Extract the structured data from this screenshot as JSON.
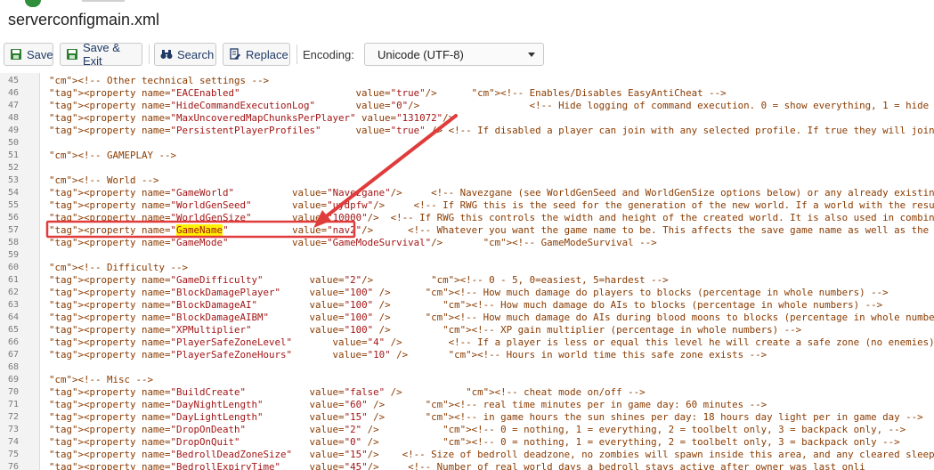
{
  "window": {
    "title": "serverconfigmain.xml"
  },
  "toolbar": {
    "save_label": "Save",
    "save_exit_label": "Save & Exit",
    "search_label": "Search",
    "replace_label": "Replace",
    "encoding_label": "Encoding:",
    "encoding_value": "Unicode (UTF-8)"
  },
  "highlight": {
    "search_match": "GameName"
  },
  "colors": {
    "annotation": "#e03c3c",
    "match_highlight": "#fff200"
  },
  "lines": [
    {
      "n": "45",
      "text": "<!-- Other technical settings -->"
    },
    {
      "n": "46",
      "text": "<property name=\"EACEnabled\"                    value=\"true\"/>      <!-- Enables/Disables EasyAntiCheat -->"
    },
    {
      "n": "47",
      "text": "<property name=\"HideCommandExecutionLog\"       value=\"0\"/>                   <!-- Hide logging of command execution. 0 = show everything, 1 = hide only from"
    },
    {
      "n": "48",
      "text": "<property name=\"MaxUncoveredMapChunksPerPlayer\" value=\"131072\"/>"
    },
    {
      "n": "49",
      "text": "<property name=\"PersistentPlayerProfiles\"      value=\"true\" /> <!-- If disabled a player can join with any selected profile. If true they will join with t"
    },
    {
      "n": "50",
      "text": ""
    },
    {
      "n": "51",
      "text": "<!-- GAMEPLAY -->"
    },
    {
      "n": "52",
      "text": ""
    },
    {
      "n": "53",
      "text": "<!-- World -->"
    },
    {
      "n": "54",
      "text": "<property name=\"GameWorld\"          value=\"Navezgane\"/>     <!-- Navezgane (see WorldGenSeed and WorldGenSize options below) or any already existing world"
    },
    {
      "n": "55",
      "text": "<property name=\"WorldGenSeed\"       value=\"uydpfw\"/>     <!-- If RWG this is the seed for the generation of the new world. If a world with the resulting nam"
    },
    {
      "n": "56",
      "text": "<property name=\"WorldGenSize\"       value=\"10000\"/>  <!-- If RWG this controls the width and height of the created world. It is also used in combination wit"
    },
    {
      "n": "57",
      "text": "<property name=\"GameName\"           value=\"nav2\"/>      <!-- Whatever you want the game name to be. This affects the save game name as well as the seed use"
    },
    {
      "n": "58",
      "text": "<property name=\"GameMode\"           value=\"GameModeSurvival\"/>       <!-- GameModeSurvival -->"
    },
    {
      "n": "59",
      "text": ""
    },
    {
      "n": "60",
      "text": "<!-- Difficulty -->"
    },
    {
      "n": "61",
      "text": "<property name=\"GameDifficulty\"        value=\"2\"/>          <!-- 0 - 5, 0=easiest, 5=hardest -->"
    },
    {
      "n": "62",
      "text": "<property name=\"BlockDamagePlayer\"     value=\"100\" />      <!-- How much damage do players to blocks (percentage in whole numbers) -->"
    },
    {
      "n": "63",
      "text": "<property name=\"BlockDamageAI\"         value=\"100\" />         <!-- How much damage do AIs to blocks (percentage in whole numbers) -->"
    },
    {
      "n": "64",
      "text": "<property name=\"BlockDamageAIBM\"       value=\"100\" />      <!-- How much damage do AIs during blood moons to blocks (percentage in whole numbers) -->"
    },
    {
      "n": "65",
      "text": "<property name=\"XPMultiplier\"          value=\"100\" />         <!-- XP gain multiplier (percentage in whole numbers) -->"
    },
    {
      "n": "66",
      "text": "<property name=\"PlayerSafeZoneLevel\"       value=\"4\" />        <!-- If a player is less or equal this level he will create a safe zone (no enemies) when s"
    },
    {
      "n": "67",
      "text": "<property name=\"PlayerSafeZoneHours\"       value=\"10\" />       <!-- Hours in world time this safe zone exists -->"
    },
    {
      "n": "68",
      "text": ""
    },
    {
      "n": "69",
      "text": "<!-- Misc -->"
    },
    {
      "n": "70",
      "text": "<property name=\"BuildCreate\"           value=\"false\" />           <!-- cheat mode on/off -->"
    },
    {
      "n": "71",
      "text": "<property name=\"DayNightLength\"        value=\"60\" />       <!-- real time minutes per in game day: 60 minutes -->"
    },
    {
      "n": "72",
      "text": "<property name=\"DayLightLength\"        value=\"15\" />       <!-- in game hours the sun shines per day: 18 hours day light per in game day -->"
    },
    {
      "n": "73",
      "text": "<property name=\"DropOnDeath\"           value=\"2\" />           <!-- 0 = nothing, 1 = everything, 2 = toolbelt only, 3 = backpack only, -->"
    },
    {
      "n": "74",
      "text": "<property name=\"DropOnQuit\"            value=\"0\" />           <!-- 0 = nothing, 1 = everything, 2 = toolbelt only, 3 = backpack only -->"
    },
    {
      "n": "75",
      "text": "<property name=\"BedrollDeadZoneSize\"   value=\"15\"/>    <!-- Size of bedroll deadzone, no zombies will spawn inside this area, and any cleared sleeper volu"
    },
    {
      "n": "76",
      "text": "<property name=\"BedrollExpiryTime\"     value=\"45\"/>     <!-- Number of real world days a bedroll stays active after owner was last onli"
    }
  ]
}
